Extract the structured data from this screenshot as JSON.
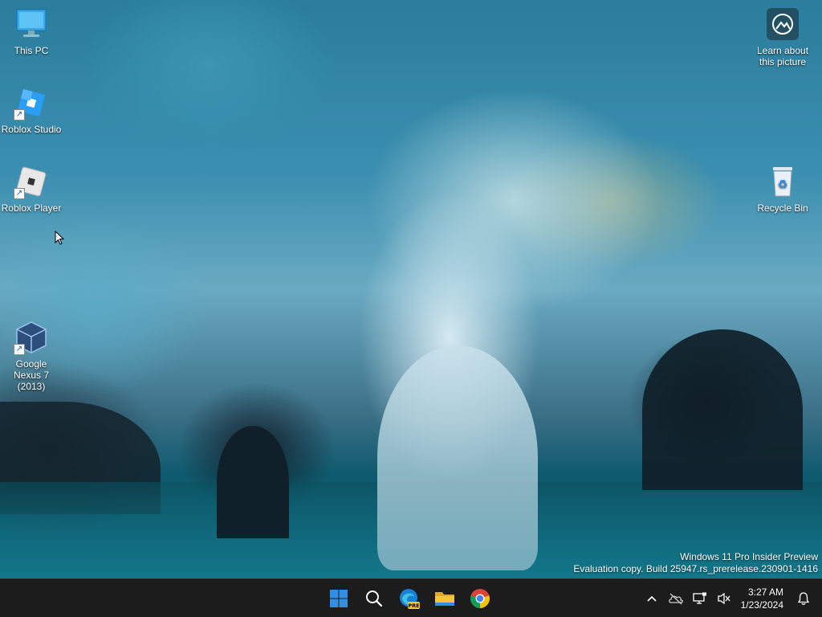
{
  "desktop": {
    "icons": [
      {
        "label": "This PC",
        "icon": "this-pc-icon"
      },
      {
        "label": "Roblox Studio",
        "icon": "roblox-studio-icon"
      },
      {
        "label": "Roblox Player",
        "icon": "roblox-player-icon"
      },
      {
        "label": "Google Nexus 7 (2013)",
        "icon": "virtualbox-icon"
      },
      {
        "label": "Learn about this picture",
        "icon": "learn-picture-icon"
      },
      {
        "label": "Recycle Bin",
        "icon": "recycle-bin-icon"
      }
    ]
  },
  "watermark": {
    "line1": "Windows 11 Pro Insider Preview",
    "line2": "Evaluation copy. Build 25947.rs_prerelease.230901-1416"
  },
  "taskbar": {
    "apps": [
      {
        "name": "Start",
        "icon": "windows-start-icon"
      },
      {
        "name": "Search",
        "icon": "search-icon"
      },
      {
        "name": "Microsoft Edge Preview",
        "icon": "edge-preview-icon",
        "badge": "PRE"
      },
      {
        "name": "File Explorer",
        "icon": "file-explorer-icon"
      },
      {
        "name": "Google Chrome",
        "icon": "chrome-icon"
      }
    ],
    "tray": {
      "icons": [
        "chevron-up-icon",
        "onedrive-icon",
        "network-icon",
        "speaker-muted-icon",
        "notification-bell-icon"
      ],
      "time": "3:27 AM",
      "date": "1/23/2024"
    }
  },
  "colors": {
    "taskbar_bg": "#1c1c1c",
    "windows_blue": "#2f8fe6",
    "folder_yellow": "#f2c53d"
  }
}
